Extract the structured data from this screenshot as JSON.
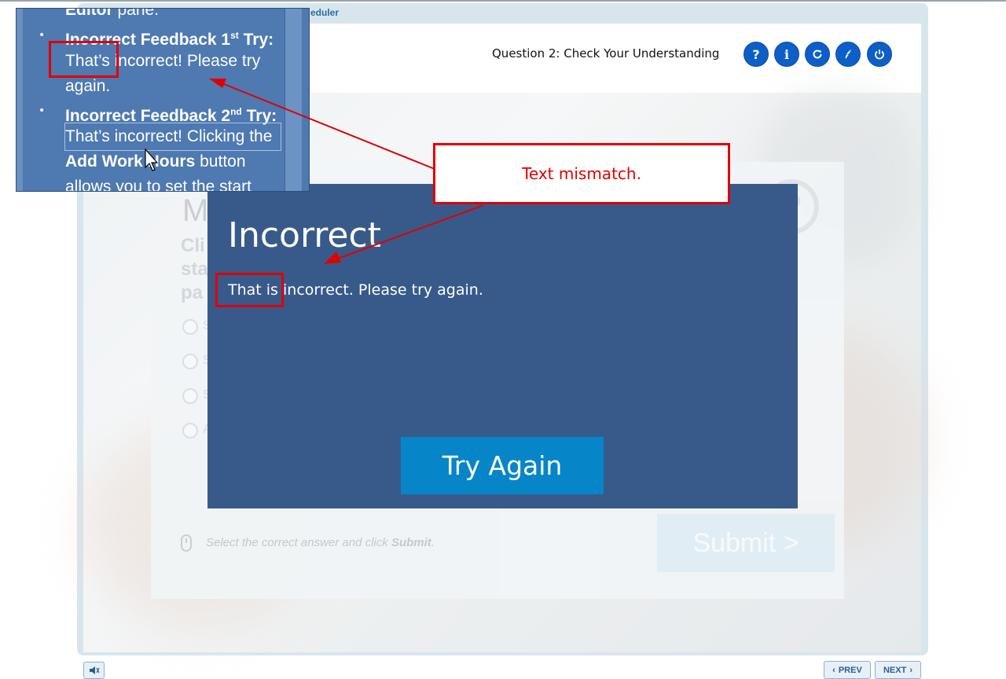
{
  "course": {
    "title_fragment": "eduler"
  },
  "header": {
    "question_title": "Question 2: Check Your Understanding",
    "buttons": [
      {
        "name": "help",
        "glyph": "?"
      },
      {
        "name": "info",
        "glyph": "i"
      },
      {
        "name": "refresh",
        "glyph": ""
      },
      {
        "name": "glossary",
        "glyph": ""
      },
      {
        "name": "exit",
        "glyph": ""
      }
    ]
  },
  "question": {
    "heading": "M",
    "prompt_line1": "Cli",
    "prompt_line2": "sta",
    "prompt_line3": "pa",
    "options": [
      "S",
      "S",
      "S",
      "A"
    ],
    "help_glyph": "?",
    "instruction_pre": "Select the correct answer and click ",
    "instruction_bold": "Submit",
    "instruction_post": ".",
    "submit_label": "Submit  >"
  },
  "modal": {
    "title": "Incorrect",
    "message": "That is incorrect. Please try again.",
    "button": "Try Again"
  },
  "inset": {
    "line0_bold": "Editor",
    "line0_rest": " pane.",
    "line1": "Incorrect Feedback 1",
    "line1_sup": "st",
    "line1_suffix": " Try:",
    "line2": "That’s incorrect! Please try",
    "line3": "again.",
    "line4": "Incorrect Feedback 2",
    "line4_sup": "nd",
    "line4_suffix": " Try:",
    "line5": "That’s incorrect! Clicking the",
    "line6_bold": "Add Work Hours",
    "line6_rest": " button",
    "line7": "allows you to set the start"
  },
  "annotation": {
    "label": "Text mismatch."
  },
  "footer": {
    "prev": "PREV",
    "next": "NEXT"
  },
  "colors": {
    "modal_bg": "#385a8b",
    "try_again": "#0686c8",
    "annotation": "#e00000",
    "header_buttons": "#0d5fc8"
  }
}
